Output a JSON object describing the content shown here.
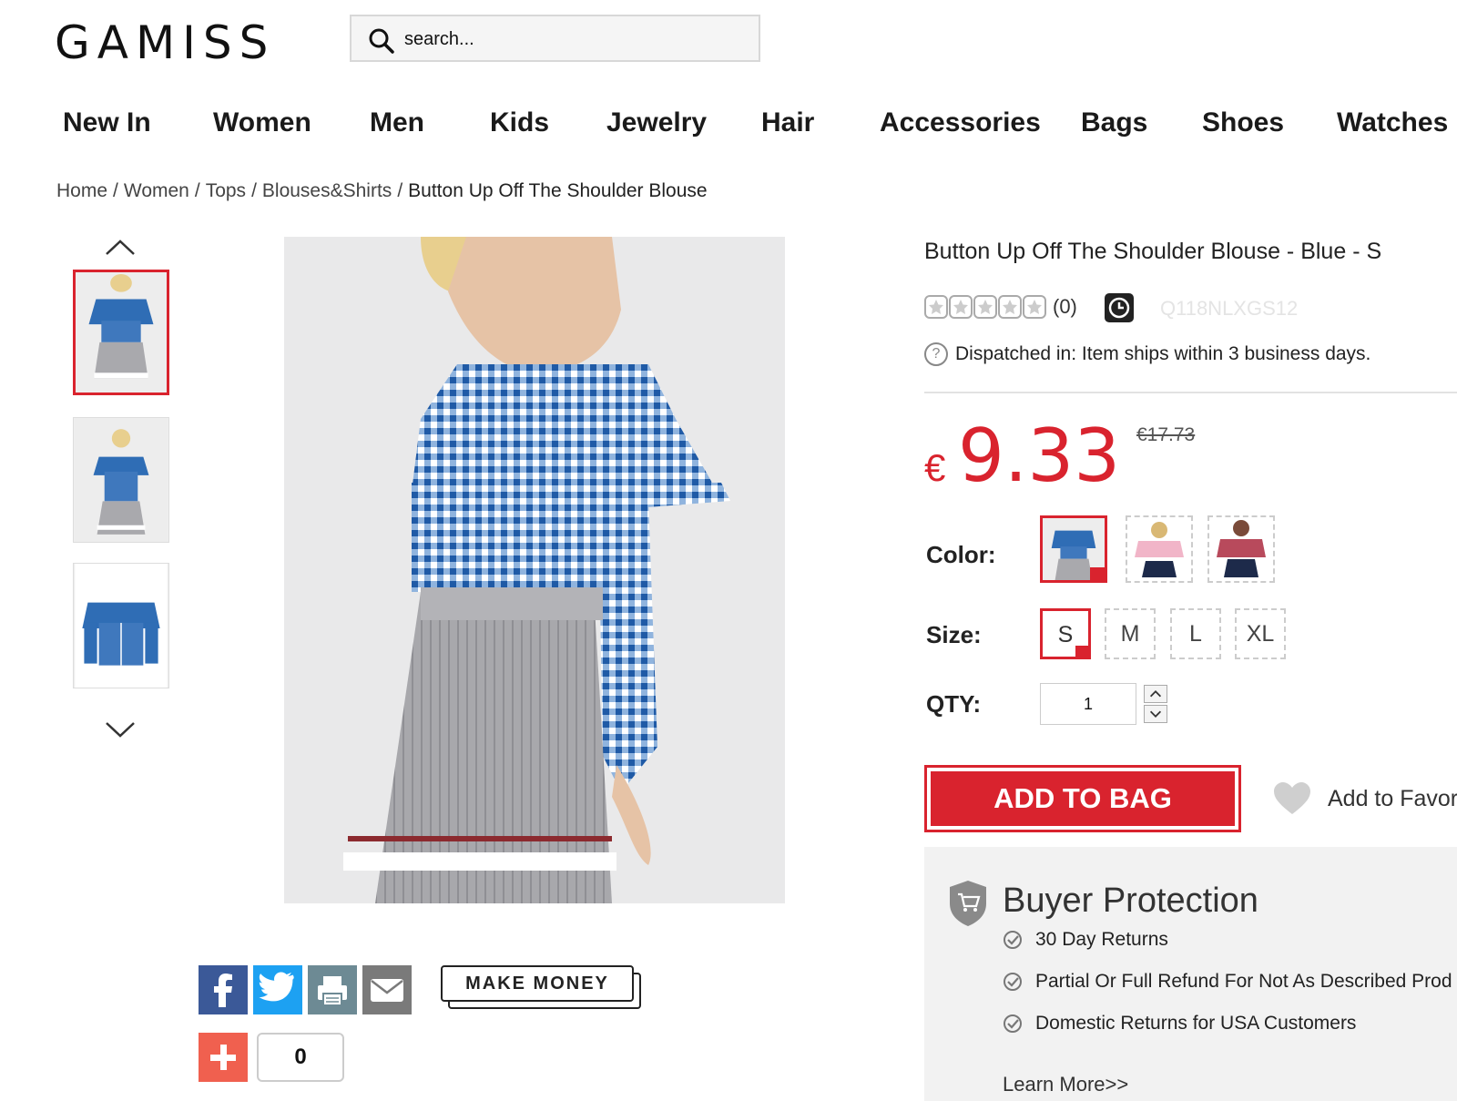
{
  "header": {
    "logo": "GAMISS",
    "search_placeholder": "search..."
  },
  "nav": [
    "New In",
    "Women",
    "Men",
    "Kids",
    "Jewelry",
    "Hair",
    "Accessories",
    "Bags",
    "Shoes",
    "Watches"
  ],
  "breadcrumb": {
    "links": [
      "Home",
      "Women",
      "Tops",
      "Blouses&Shirts"
    ],
    "current": "Button Up Off The Shoulder Blouse"
  },
  "product": {
    "title": "Button Up Off The Shoulder Blouse - Blue - S",
    "rating_count": "(0)",
    "sku": "Q118NLXGS12",
    "dispatch": "Dispatched in: Item ships within 3 business days.",
    "currency_symbol": "€",
    "price": "9.33",
    "old_price": "€17.73",
    "color_label": "Color:",
    "size_label": "Size:",
    "qty_label": "QTY:",
    "qty_value": "1",
    "sizes": [
      "S",
      "M",
      "L",
      "XL"
    ],
    "selected_size": "S",
    "add_to_bag": "ADD TO BAG",
    "add_to_favorites": "Add to Favori"
  },
  "share": {
    "make_money": "MAKE MONEY",
    "plus_count": "0"
  },
  "buyer_protection": {
    "title": "Buyer Protection",
    "items": [
      "30 Day Returns",
      "Partial Or Full Refund For Not As Described Prod",
      "Domestic Returns for USA Customers"
    ],
    "learn_more": "Learn More>>"
  },
  "colors": {
    "accent": "#d9232e",
    "gingham_blue": "#2f6db5",
    "facebook": "#3b5998",
    "twitter": "#1da1f2",
    "print": "#6d8a94",
    "email": "#7a7a7a",
    "plus": "#f0604f"
  }
}
